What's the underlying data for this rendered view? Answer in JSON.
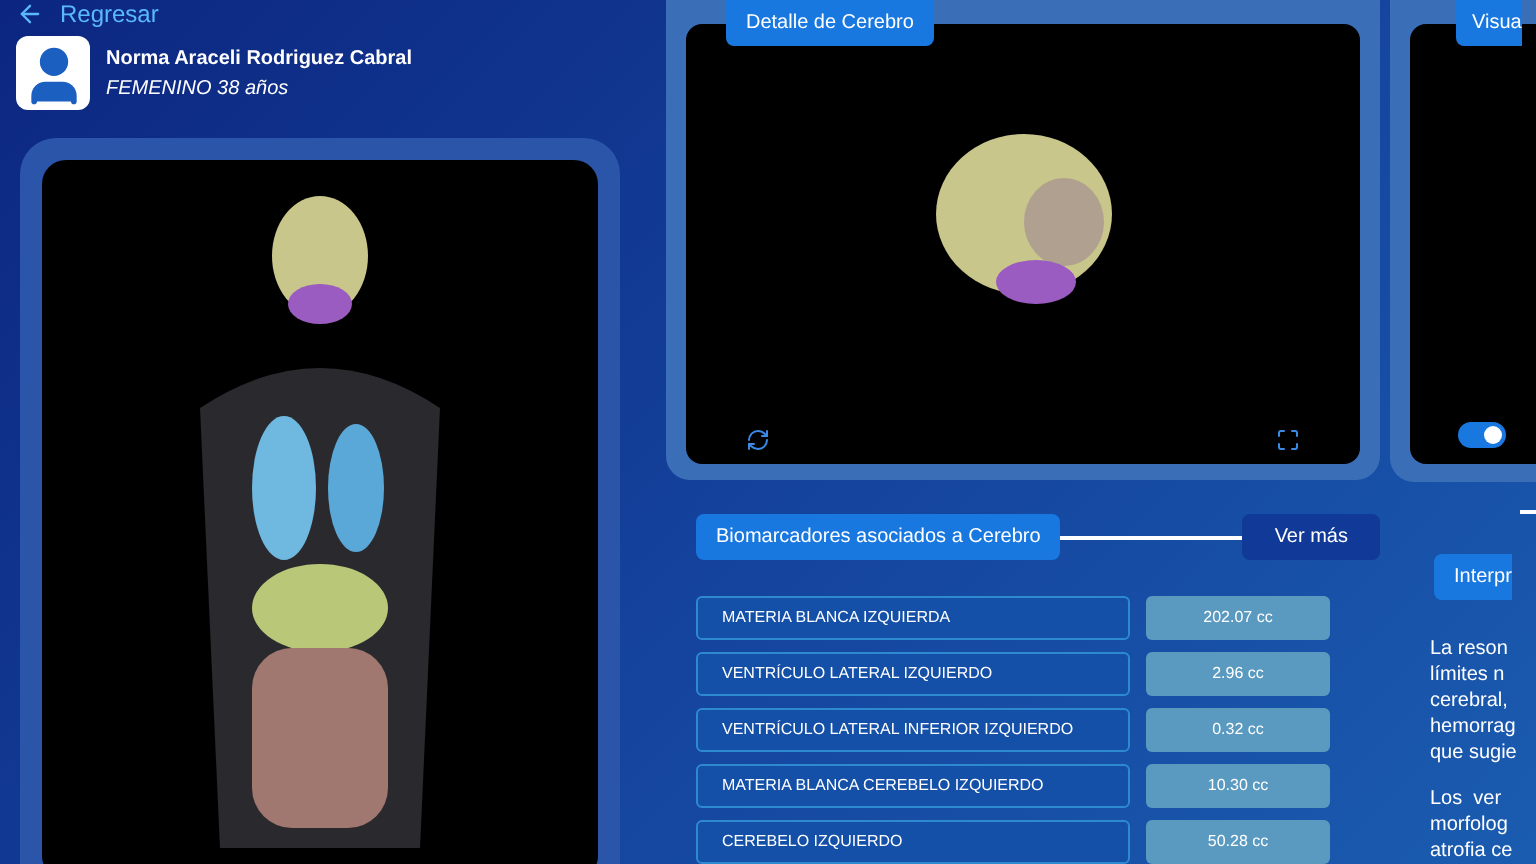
{
  "back_link": {
    "label": "Regresar"
  },
  "patient": {
    "name": "Norma Araceli Rodriguez Cabral",
    "details": "FEMENINO 38 años"
  },
  "brain_detail": {
    "title": "Detalle de Cerebro"
  },
  "biomarkers": {
    "title": "Biomarcadores asociados a Cerebro",
    "more_button": "Ver más",
    "rows": [
      {
        "name": "MATERIA BLANCA IZQUIERDA",
        "value": "202.07 cc"
      },
      {
        "name": "VENTRÍCULO LATERAL IZQUIERDO",
        "value": "2.96 cc"
      },
      {
        "name": "VENTRÍCULO LATERAL INFERIOR IZQUIERDO",
        "value": "0.32 cc"
      },
      {
        "name": "MATERIA BLANCA CEREBELO IZQUIERDO",
        "value": "10.30 cc"
      },
      {
        "name": "CEREBELO IZQUIERDO",
        "value": "50.28 cc"
      }
    ]
  },
  "visual_panel": {
    "title": "Visua",
    "toggle": {
      "on": true
    }
  },
  "interpretation": {
    "button": "Interpr",
    "paragraphs": [
      [
        "La reson",
        "límites n",
        "cerebral,",
        "hemorrag",
        "que sugie"
      ],
      [
        "Los  ver",
        "morfolog",
        "atrofia ce"
      ]
    ]
  }
}
